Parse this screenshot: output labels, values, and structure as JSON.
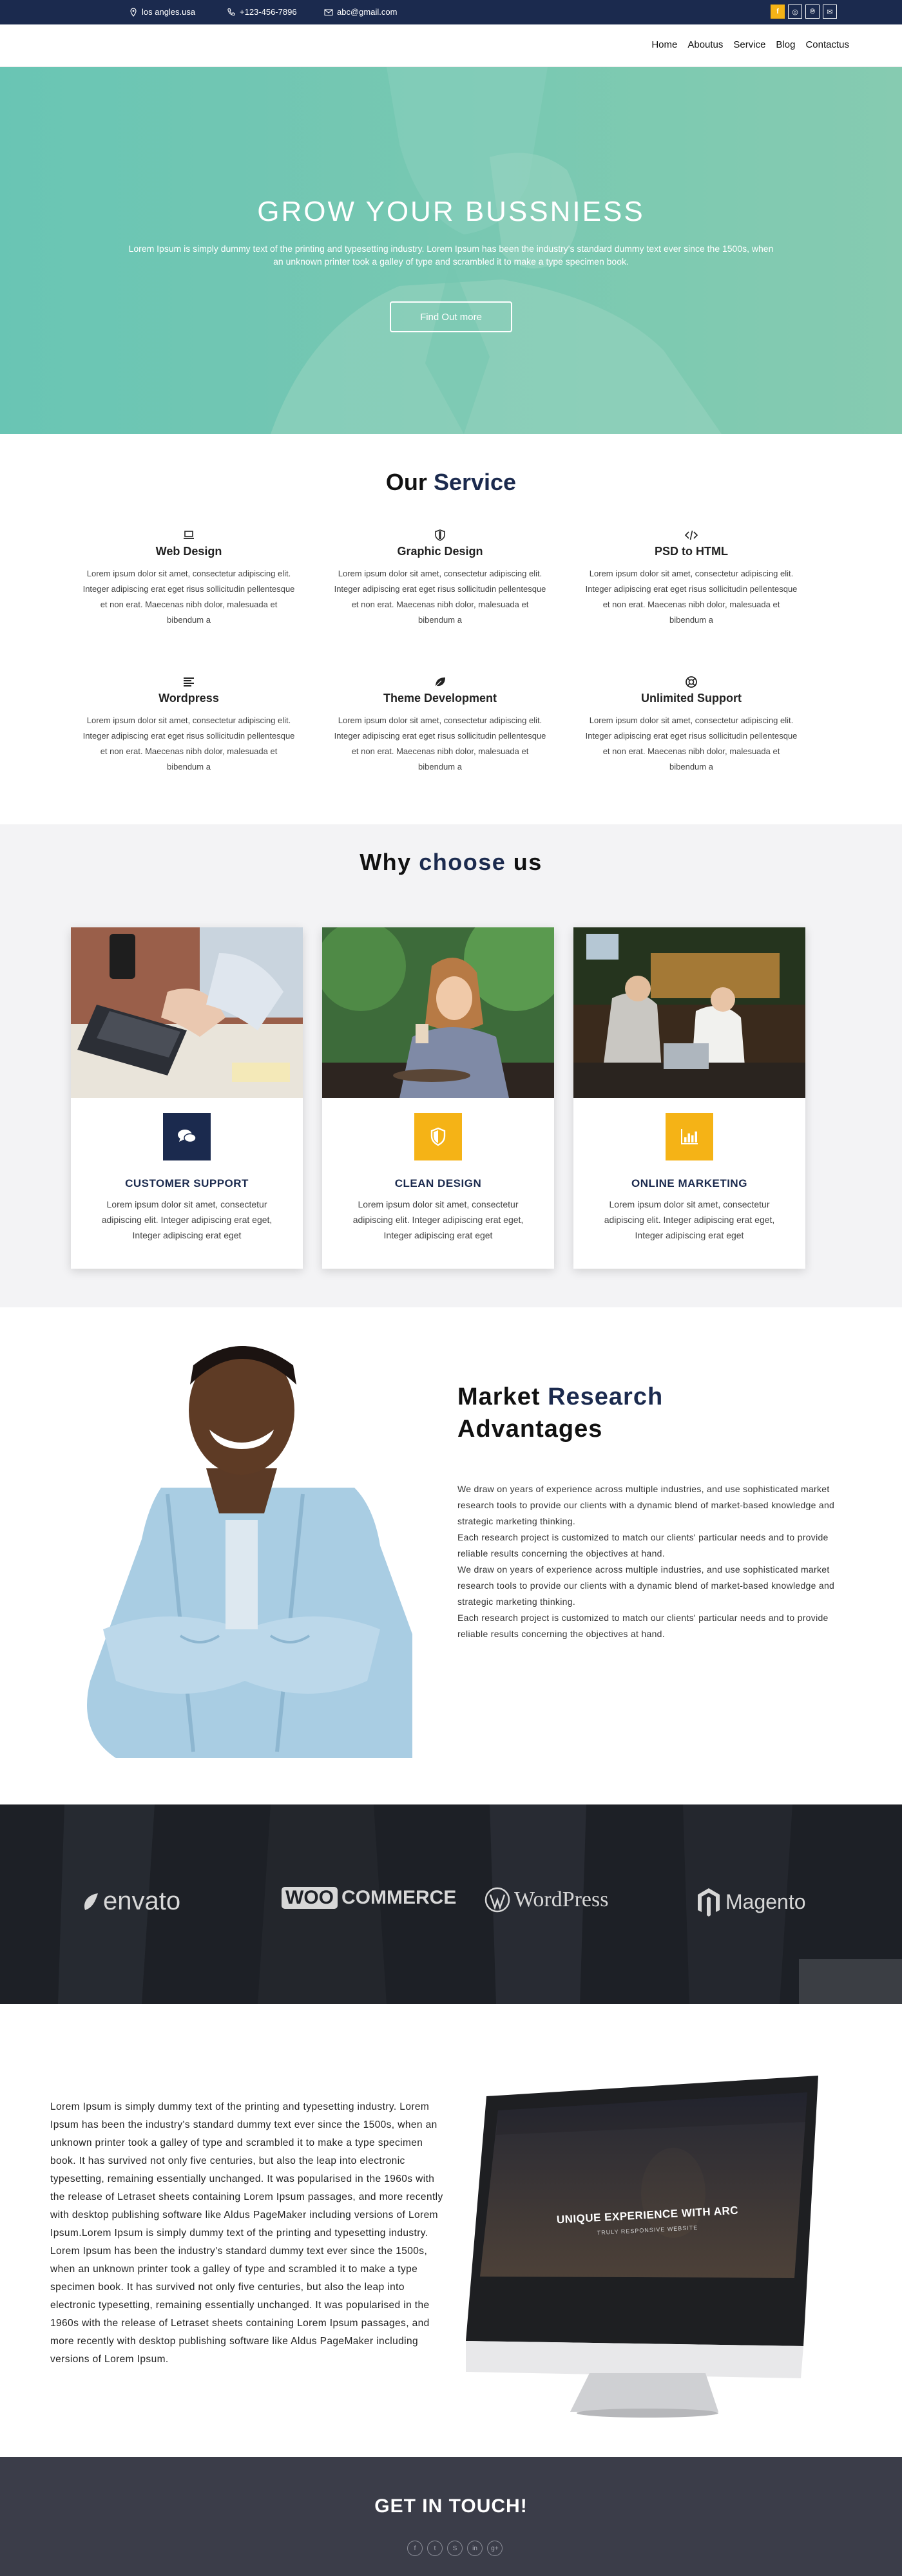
{
  "topbar": {
    "location": "los angles.usa",
    "phone": "+123-456-7896",
    "email": "abc@gmail.com",
    "socials": [
      "f",
      "◎",
      "℗",
      "✉"
    ]
  },
  "nav": {
    "items": [
      "Home",
      "Aboutus",
      "Service",
      "Blog",
      "Contactus"
    ]
  },
  "hero": {
    "title": "GROW YOUR BUSSNIESS",
    "text": "Lorem Ipsum is simply dummy text of the printing and typesetting industry. Lorem Ipsum has been the industry's standard dummy text ever since the 1500s, when an unknown printer took a galley of type and scrambled it to make a type specimen book.",
    "button": "Find Out more"
  },
  "services": {
    "title_prefix": "Our",
    "title_accent": "Service",
    "items": [
      {
        "icon": "laptop-icon",
        "title": "Web Design",
        "text": "Lorem ipsum dolor sit amet, consectetur adipiscing elit. Integer adipiscing erat eget risus sollicitudin pellentesque et non erat. Maecenas nibh dolor, malesuada et bibendum a"
      },
      {
        "icon": "shield-icon",
        "title": "Graphic Design",
        "text": "Lorem ipsum dolor sit amet, consectetur adipiscing elit. Integer adipiscing erat eget risus sollicitudin pellentesque et non erat. Maecenas nibh dolor, malesuada et bibendum a"
      },
      {
        "icon": "code-icon",
        "title": "PSD to HTML",
        "text": "Lorem ipsum dolor sit amet, consectetur adipiscing elit. Integer adipiscing erat eget risus sollicitudin pellentesque et non erat. Maecenas nibh dolor, malesuada et bibendum a"
      },
      {
        "icon": "align-icon",
        "title": "Wordpress",
        "text": "Lorem ipsum dolor sit amet, consectetur adipiscing elit. Integer adipiscing erat eget risus sollicitudin pellentesque et non erat. Maecenas nibh dolor, malesuada et bibendum a"
      },
      {
        "icon": "leaf-icon",
        "title": "Theme Development",
        "text": "Lorem ipsum dolor sit amet, consectetur adipiscing elit. Integer adipiscing erat eget risus sollicitudin pellentesque et non erat. Maecenas nibh dolor, malesuada et bibendum a"
      },
      {
        "icon": "lifebuoy-icon",
        "title": "Unlimited Support",
        "text": "Lorem ipsum dolor sit amet, consectetur adipiscing elit. Integer adipiscing erat eget risus sollicitudin pellentesque et non erat. Maecenas nibh dolor, malesuada et bibendum a"
      }
    ]
  },
  "why": {
    "title_prefix": "Why",
    "title_accent": "choose",
    "title_suffix": "us",
    "cards": [
      {
        "icon": "chat-icon",
        "title": "CUSTOMER SUPPORT",
        "text": "Lorem ipsum dolor sit amet, consectetur adipiscing elit. Integer adipiscing erat eget, Integer adipiscing erat eget"
      },
      {
        "icon": "shield-icon",
        "title": "CLEAN DESIGN",
        "text": "Lorem ipsum dolor sit amet, consectetur adipiscing elit. Integer adipiscing erat eget, Integer adipiscing erat eget"
      },
      {
        "icon": "bar-chart-icon",
        "title": "ONLINE MARKETING",
        "text": "Lorem ipsum dolor sit amet, consectetur adipiscing elit. Integer adipiscing erat eget, Integer adipiscing erat eget"
      }
    ]
  },
  "market": {
    "title_line1_prefix": "Market",
    "title_line1_accent": "Research",
    "title_line2": "Advantages",
    "text": "We draw on years of experience across multiple industries, and use sophisticated market research tools to provide our clients with a dynamic blend of market-based knowledge and strategic marketing thinking.\nEach research project is customized to match our clients' particular needs and to provide reliable results concerning the objectives at hand.\nWe draw on years of experience across multiple industries, and use sophisticated market research tools to provide our clients with a dynamic blend of market-based knowledge and strategic marketing thinking.\nEach research project is customized to match our clients' particular needs and to provide reliable results concerning the objectives at hand."
  },
  "partners": {
    "envato": "envato",
    "woo_box": "WOO",
    "woo_rest": "COMMERCE",
    "wordpress": "WordPress",
    "magento": "Magento"
  },
  "promo": {
    "text": "Lorem Ipsum is simply dummy text of the printing and typesetting industry. Lorem Ipsum has been the industry's standard dummy text ever since the 1500s, when an unknown printer took a galley of type and scrambled it to make a type specimen book. It has survived not only five centuries, but also the leap into electronic typesetting, remaining essentially unchanged. It was popularised in the 1960s with the release of Letraset sheets containing Lorem Ipsum passages, and more recently with desktop publishing software like Aldus PageMaker including versions of Lorem Ipsum.Lorem Ipsum is simply dummy text of the printing and typesetting industry. Lorem Ipsum has been the industry's standard dummy text ever since the 1500s, when an unknown printer took a galley of type and scrambled it to make a type specimen book. It has survived not only five centuries, but also the leap into electronic typesetting, remaining essentially unchanged. It was popularised in the 1960s with the release of Letraset sheets containing Lorem Ipsum passages, and more recently with desktop publishing software like Aldus PageMaker including versions of Lorem Ipsum.",
    "screen_title": "UNIQUE EXPERIENCE WITH ARC",
    "screen_sub": "TRULY RESPONSIVE WEBSITE"
  },
  "footer": {
    "title": "GET IN TOUCH!",
    "socials": [
      "f",
      "t",
      "S",
      "in",
      "g+"
    ]
  }
}
